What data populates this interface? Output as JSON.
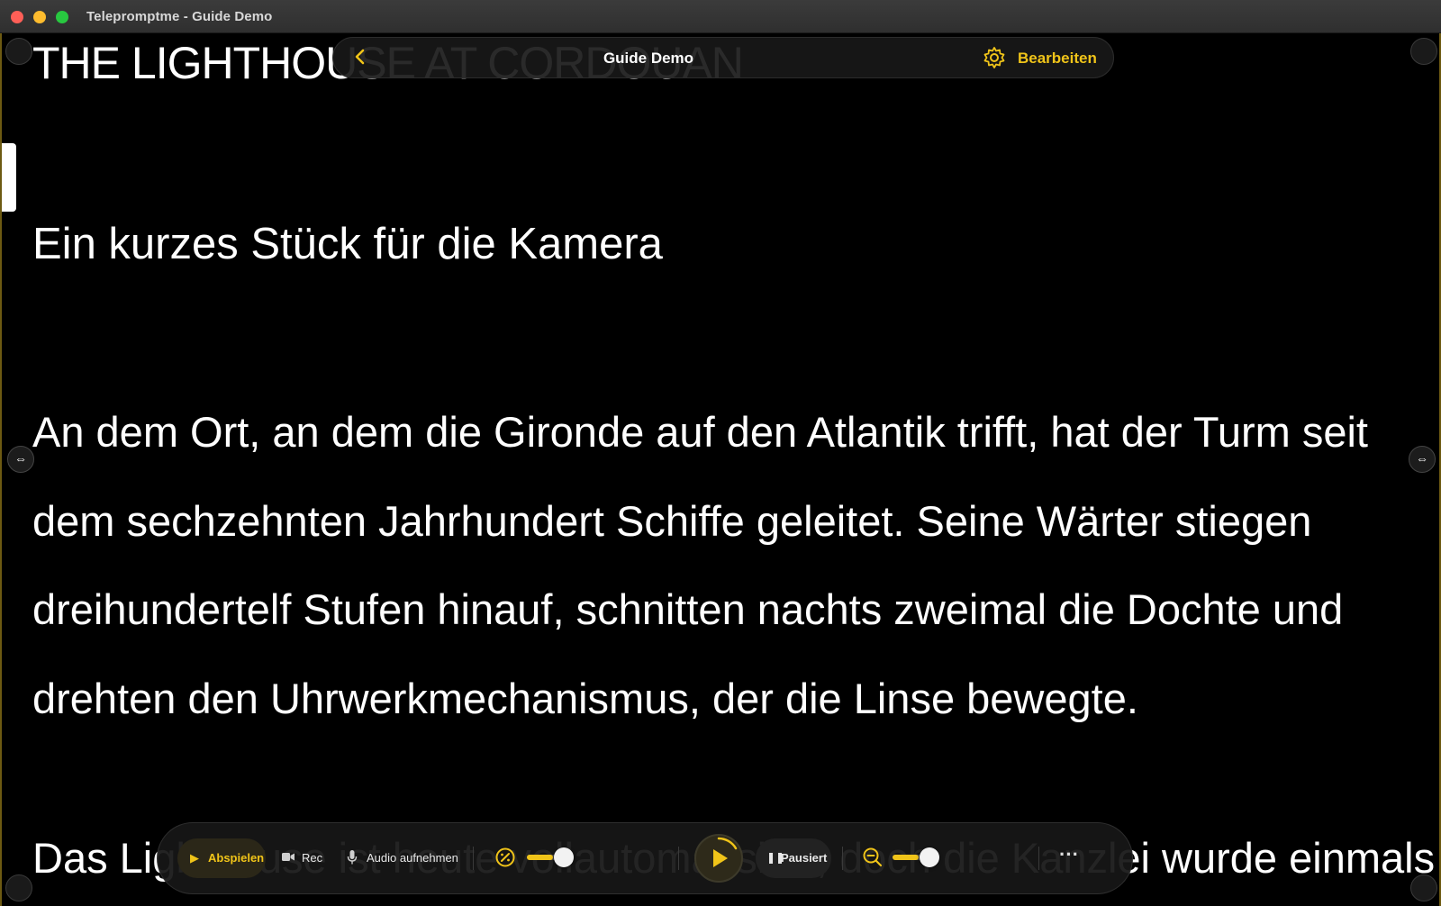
{
  "window": {
    "title": "Telepromptme - Guide Demo"
  },
  "header": {
    "title": "Guide Demo",
    "edit_label": "Bearbeiten",
    "back_icon": "chevron-left-icon",
    "edit_icon": "gear-icon"
  },
  "script": {
    "heading": "THE LIGHTHOUSE AT CORDOUAN",
    "subtitle": "Ein kurzes Stück für die Kamera",
    "paragraph": "An dem Ort, an dem die Gironde auf den Atlantik trifft, hat der Turm seit dem sechzehnten Jahrhundert Schiffe geleitet. Seine Wärter stiegen dreihundertelf Stufen hinauf, schnitten nachts zweimal die Dochte und drehten den Uhrwerkmechanismus, der die Linse bewegte.",
    "next_line": "Das Lighthouse ist heute vollautomatisiert, doch die Kanzlei wurde einmals mehr"
  },
  "controls": {
    "play_label": "Abspielen",
    "rec_label": "Rec",
    "audio_label": "Audio aufnehmen",
    "speed_level": 0.6,
    "paused_label": "Pausiert",
    "zoom_level": 0.6,
    "more_icon": "ellipsis-icon"
  },
  "colors": {
    "accent": "#f0c419",
    "background": "#000000",
    "text": "#ffffff"
  }
}
